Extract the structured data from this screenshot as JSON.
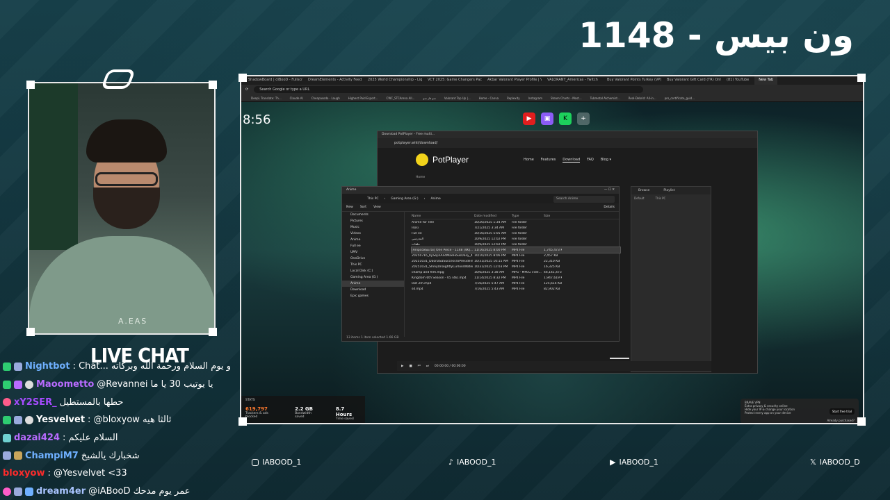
{
  "overlay": {
    "title": "ون بيس - 1148",
    "chat_title": "LIVE CHAT",
    "shirt_print": "A.EAS"
  },
  "socials": [
    {
      "icon": "instagram-icon",
      "handle": "IABOOD_1"
    },
    {
      "icon": "tiktok-icon",
      "handle": "IABOOD_1"
    },
    {
      "icon": "youtube-icon",
      "handle": "IABOOD_1"
    },
    {
      "icon": "x-icon",
      "handle": "IABOOD_D"
    }
  ],
  "chat": [
    {
      "user": "Nightbot",
      "color": "#6fb0ff",
      "text": ": Chat... و یوم السلام ورحمة الله وبركاته"
    },
    {
      "user": "Maoometto",
      "color": "#b86bff",
      "text": "@Revannei يا يوتيب 30 يا ما"
    },
    {
      "user": "xY2SER_",
      "color": "#a64cff",
      "text": "حطها بالمستطيل"
    },
    {
      "user": "Yesvelvet",
      "color": "#ffffff",
      "text": ": @bloxyow ثالثا هيه"
    },
    {
      "user": "dazai424",
      "color": "#b86bff",
      "text": ": السلام عليكم"
    },
    {
      "user": "ChampiM7",
      "color": "#6fb0ff",
      "text": "شخبارك يالشيخ"
    },
    {
      "user": "bloxyow",
      "color": "#ff2b2b",
      "text": ": @Yesvelvet <33"
    },
    {
      "user": "dream4er",
      "color": "#a9c4ff",
      "text": "@iABooD عمر يوم مدحك"
    }
  ],
  "screen": {
    "clock": "8:56",
    "tabs": [
      "ShadowBoard | diBooD - Fullscre",
      "DreamElements - Activity Feed",
      "2025 World Championship - Liqui",
      "VCT 2025: Game Changers Pacific",
      "Akbar Valorant Player Profile | VLR",
      "VALORANT_Americas - Twitch",
      "Buy Valorant Points Turkey (VP)",
      "Buy Valorant Gift Card (TR) Online",
      "(81) YouTube",
      "New Tab"
    ],
    "address": "Search Google or type a URL",
    "bookmarks": [
      "DeepL Translate: Th...",
      "Claude AI",
      "Cheapasoda - Laugh",
      "Highest Paid Esport...",
      "CWC_STCArena All...",
      "منو فاز منو",
      "Valorant Top Up |...",
      "Home - Canva",
      "Replexity",
      "Instagram",
      "Steam Charts - Most...",
      "Tubmetal Alchemist...",
      "Real-Debrid: All-in...",
      "pro_certificate_guid..."
    ],
    "shortcuts": [
      "YouTube",
      "Twitch",
      "KICK",
      "Add site"
    ],
    "potplayer": {
      "window_title": "Download PotPlayer - Free multi...",
      "url": "potplayer.wiki/download/",
      "brand": "PotPlayer",
      "menu": [
        "Home",
        "Features",
        "Download",
        "FAQ",
        "Blog ▾"
      ],
      "breadcrumb": "Home",
      "playlist_tabs": [
        "Browse",
        "Playlist"
      ],
      "playlist_sub": [
        "Default",
        "This PC"
      ],
      "time": "00:00:00 / 00:00:00"
    },
    "explorer": {
      "title": "Anime",
      "path": [
        "This PC",
        "Gaming Area (G:)",
        "Anime"
      ],
      "search_placeholder": "Search Anime",
      "toolbar": [
        "New",
        "Sort",
        "View",
        "Details"
      ],
      "sidebar": [
        "Documents",
        "Pictures",
        "Music",
        "Videos",
        "Anime",
        "Full ee",
        "UMV",
        "OneDrive",
        "This PC",
        "Local Disk (C:)",
        "Gaming Area (G:)",
        "Anime",
        "Download",
        "Epic games"
      ],
      "columns": [
        "Name",
        "Date modified",
        "Type",
        "Size"
      ],
      "rows": [
        {
          "name": "Anime for Tele",
          "date": "10/20/2025 1:34 AM",
          "type": "File folder",
          "size": ""
        },
        {
          "name": "Isosi",
          "date": "7/21/2025 3:34 AM",
          "type": "File folder",
          "size": ""
        },
        {
          "name": "Full ee",
          "date": "10/16/2025 5:05 AM",
          "type": "File folder",
          "size": ""
        },
        {
          "name": "المدرسي",
          "date": "10/9/2025 12:02 PM",
          "type": "File folder",
          "size": ""
        },
        {
          "name": "ملفات",
          "date": "10/9/2025 12:02 PM",
          "type": "File folder",
          "size": ""
        },
        {
          "name": "[Anipcox&Erai] One Piece - 1148 [4K]...",
          "date": "11/16/2025 8:00 PM",
          "type": "MP4 File",
          "size": "1,745,473 KB"
        },
        {
          "name": "20250716_KySeJinAndMaeHoukDaily_4...",
          "date": "10/10/2025 8:06 PM",
          "type": "MP4 File",
          "size": "2,457 KB"
        },
        {
          "name": "20251031_DaonaSaSuccessToPresidentDi...",
          "date": "10/31/2025 10:15 AM",
          "type": "MP4 File",
          "size": "22,310 KB"
        },
        {
          "name": "20251031_ShinyUnaightlyCurlossWaterMan...",
          "date": "10/31/2025 12:03 PM",
          "type": "MP4 File",
          "size": "16,325 KB"
        },
        {
          "name": "champ and film.mpg",
          "date": "10/6/2025 3:38 AM",
          "type": "MPG - MPEG vide...",
          "size": "46,141,473 ..."
        },
        {
          "name": "Kingdom 6th Season - 05 (4k).mp4",
          "date": "11/14/2025 8:32 PM",
          "type": "MP4 File",
          "size": "1,947,619 KB"
        },
        {
          "name": "last 2m.mp4",
          "date": "7/16/2025 5:47 AM",
          "type": "MP4 File",
          "size": "125,614 KB"
        },
        {
          "name": "sd.mp4",
          "date": "7/16/2025 5:43 AM",
          "type": "MP4 File",
          "size": "82,902 KB"
        }
      ],
      "status": "13 items   1 item selected  1.66 GB"
    },
    "stats": {
      "label": "STATS",
      "items": [
        {
          "value": "619,797",
          "caption": "Trackers & ads blocked"
        },
        {
          "value": "2.2 GB",
          "caption": "Bandwidth saved"
        },
        {
          "value": "8.7 Hours",
          "caption": "Time saved"
        }
      ]
    },
    "vpn": {
      "title": "BRAVE VPN",
      "lines": [
        "Extra privacy & security online",
        "Hide your IP & change your location",
        "Protect every app on your device"
      ],
      "button": "Start free trial",
      "footer": "Already purchased?"
    }
  }
}
